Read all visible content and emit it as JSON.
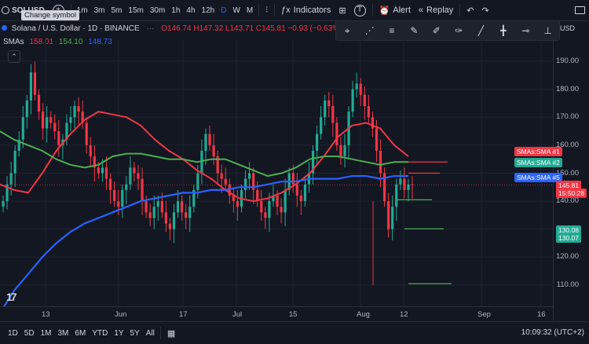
{
  "toolbar": {
    "symbol": "SOLUSD",
    "intervals": [
      "1m",
      "3m",
      "5m",
      "15m",
      "30m",
      "1h",
      "4h",
      "12h",
      "D",
      "W",
      "M"
    ],
    "active_interval": "D",
    "indicators_label": "Indicators",
    "alert_label": "Alert",
    "replay_label": "Replay",
    "tooltip": "Change symbol"
  },
  "legend": {
    "title": "Solana / U.S. Dollar · 1D · BINANCE",
    "open": "O146.74",
    "high": "H147.32",
    "low": "L143.71",
    "close": "C145.81",
    "change": "−0.93 (−0.63%)",
    "sma_label": "SMAs",
    "sma_values": [
      "158.01",
      "154.10",
      "148.73"
    ]
  },
  "drawing_toolbar": {
    "currency": "USD"
  },
  "price_axis": {
    "ticks": [
      "190.00",
      "180.00",
      "170.00",
      "160.00",
      "150.00",
      "140.00",
      "130.00",
      "120.00",
      "110.00"
    ],
    "tags": [
      {
        "text": "SMAs:SMA #1",
        "color": "#f23645"
      },
      {
        "text": "SMAs:SMA #2",
        "color": "#22ab94"
      },
      {
        "text": "SMAs:SMA #5",
        "color": "#2962ff"
      }
    ],
    "last_price": "145.81",
    "countdown": "15:50:28",
    "lvl1": "130.08",
    "lvl2": "130.07"
  },
  "time_axis": [
    "13",
    "Jun",
    "17",
    "Jul",
    "15",
    "Aug",
    "12",
    "Sep",
    "16"
  ],
  "bottom": {
    "ranges": [
      "1D",
      "5D",
      "1M",
      "3M",
      "6M",
      "YTD",
      "1Y",
      "5Y",
      "All"
    ],
    "clock": "10:09:32 (UTC+2)"
  },
  "colors": {
    "up": "#22ab94",
    "down": "#f23645",
    "sma1": "#f23645",
    "sma2": "#4caf50",
    "sma5": "#2962ff"
  },
  "chart_data": {
    "type": "candlestick",
    "ylim": [
      100,
      195
    ],
    "sma_series": [
      {
        "name": "SMA #1",
        "color": "#f23645",
        "values": [
          146,
          144,
          143,
          150,
          158,
          164,
          169,
          172,
          171,
          170,
          167,
          162,
          158,
          155,
          151,
          148,
          144,
          141,
          140,
          141,
          143,
          146,
          150,
          156,
          163,
          167,
          168,
          166,
          160,
          156
        ]
      },
      {
        "name": "SMA #2",
        "color": "#4caf50",
        "values": [
          165,
          162,
          160,
          158,
          155,
          153,
          152,
          153,
          156,
          157,
          157,
          156,
          155,
          155,
          154,
          155,
          155,
          153,
          151,
          149,
          150,
          152,
          155,
          156,
          156,
          155,
          154,
          153,
          154,
          154
        ]
      },
      {
        "name": "SMA #5",
        "color": "#2962ff",
        "values": [
          100,
          108,
          114,
          120,
          125,
          129,
          132,
          134,
          136,
          138,
          140,
          141,
          142,
          143,
          143,
          144,
          144,
          145,
          145,
          146,
          147,
          147,
          148,
          148,
          148,
          149,
          149,
          148,
          149,
          149
        ]
      }
    ]
  }
}
